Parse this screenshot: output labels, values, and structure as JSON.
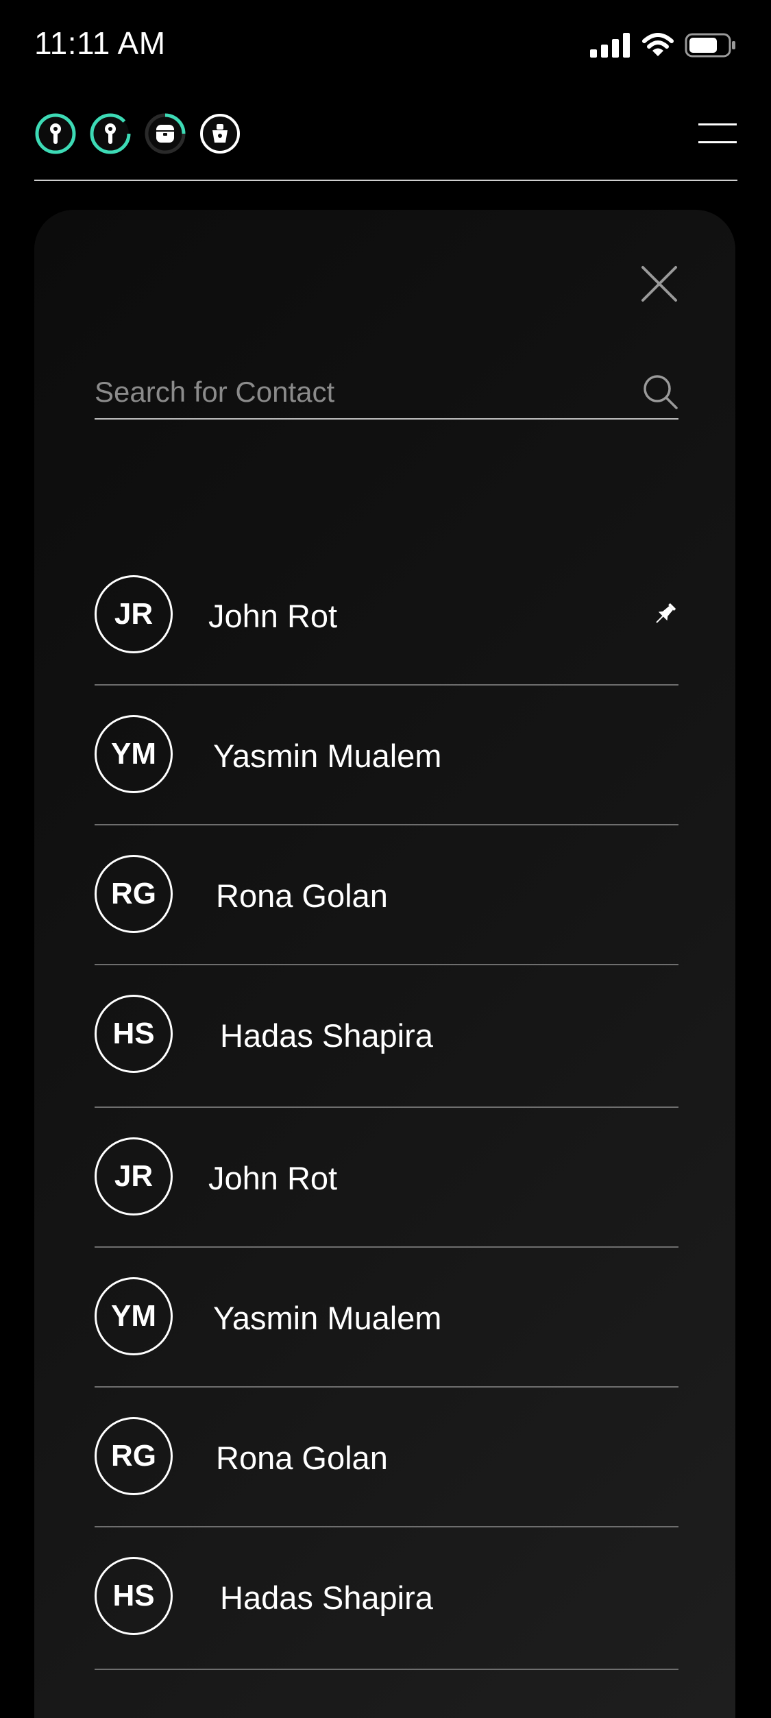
{
  "status_bar": {
    "time": "11:11 AM",
    "icons": [
      "cellular-signal-icon",
      "wifi-icon",
      "battery-icon"
    ]
  },
  "device_bar": {
    "devices": [
      {
        "icon": "left-earbud-icon",
        "ring_color": "#3ddbb6"
      },
      {
        "icon": "right-earbud-icon",
        "ring_color": "#3ddbb6"
      },
      {
        "icon": "charging-case-icon",
        "ring_color": "#3ddbb6"
      },
      {
        "icon": "wrist-device-icon",
        "ring_color": "#ffffff"
      }
    ],
    "menu_icon": "hamburger-menu-icon"
  },
  "panel": {
    "close_icon": "close-icon",
    "search": {
      "placeholder": "Search for Contact",
      "value": "",
      "icon": "search-icon"
    },
    "contacts": [
      {
        "initials": "JR",
        "name": "John Rot",
        "pinned": true
      },
      {
        "initials": "YM",
        "name": "Yasmin Mualem",
        "pinned": false
      },
      {
        "initials": "RG",
        "name": "Rona Golan",
        "pinned": false
      },
      {
        "initials": "HS",
        "name": "Hadas Shapira",
        "pinned": false
      },
      {
        "initials": "JR",
        "name": "John Rot",
        "pinned": false
      },
      {
        "initials": "YM",
        "name": "Yasmin Mualem",
        "pinned": false
      },
      {
        "initials": "RG",
        "name": "Rona Golan",
        "pinned": false
      },
      {
        "initials": "HS",
        "name": "Hadas Shapira",
        "pinned": false
      }
    ]
  },
  "colors": {
    "background": "#000000",
    "accent": "#3ddbb6",
    "text": "#ffffff",
    "placeholder": "#8b8b8b",
    "divider": "#6e6e6e"
  }
}
